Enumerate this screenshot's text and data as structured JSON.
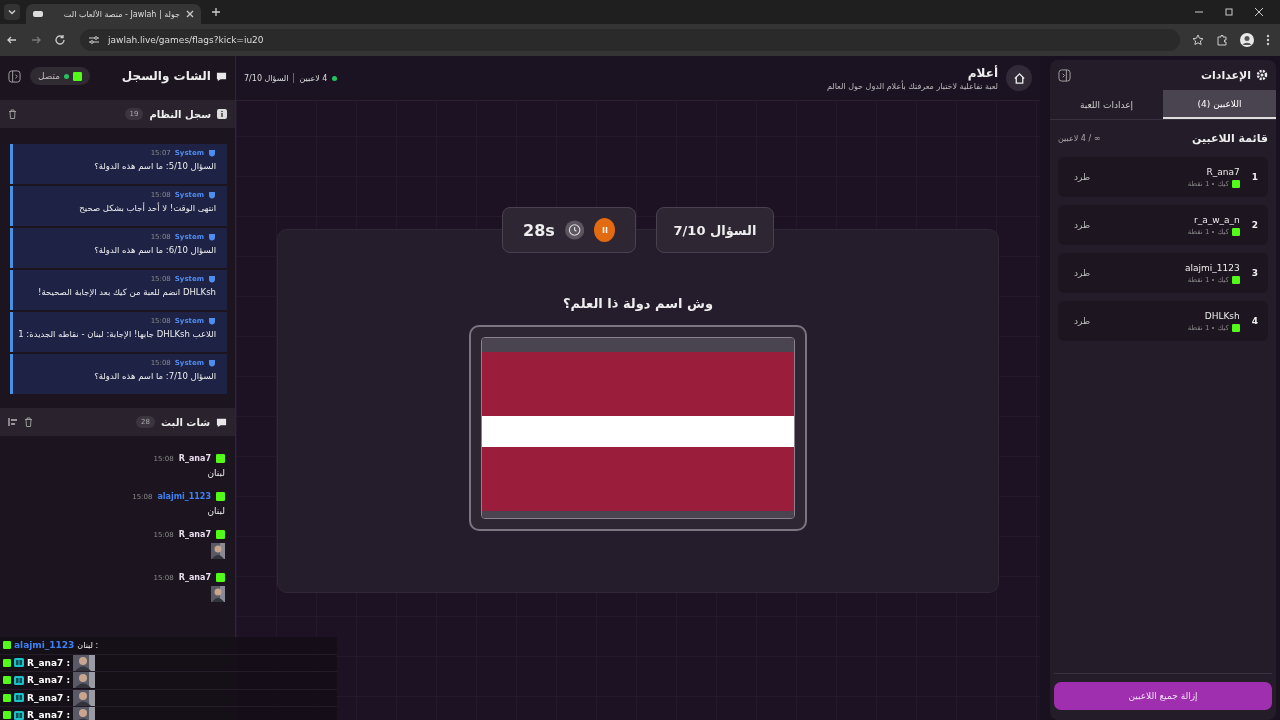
{
  "browser": {
    "tab_title": "جولة | Jawlah - منصة الألعاب الت",
    "url": "jawlah.live/games/flags?kick=iu20"
  },
  "left_panel": {
    "title": "الشات والسجل",
    "status": "متصل",
    "system_log": {
      "title": "سجل النظام",
      "count": "19",
      "entries": [
        {
          "sender": "System",
          "time": "15:07",
          "text": "السؤال 5/10: ما اسم هذه الدولة؟"
        },
        {
          "sender": "System",
          "time": "15:08",
          "text": "انتهى الوقت! لا أحد أجاب بشكل صحيح"
        },
        {
          "sender": "System",
          "time": "15:08",
          "text": "السؤال 6/10: ما اسم هذه الدولة؟"
        },
        {
          "sender": "System",
          "time": "15:08",
          "text": "DHLKsh انضم للعبة من كيك بعد الإجابة الصحيحة!"
        },
        {
          "sender": "System",
          "time": "15:08",
          "text": "اللاعب DHLKsh جابها! الإجابة: لبنان - نقاطه الجديدة: 1"
        },
        {
          "sender": "System",
          "time": "15:08",
          "text": "السؤال 7/10: ما اسم هذه الدولة؟"
        }
      ]
    },
    "stream_chat": {
      "title": "شات البث",
      "count": "28",
      "messages": [
        {
          "user": "R_ana7",
          "color": "#e8dced",
          "time": "15:08",
          "kind": "text",
          "text": "لبنان"
        },
        {
          "user": "alajmi_1123",
          "color": "#3b82f6",
          "time": "15:08",
          "kind": "text",
          "text": "لبنان"
        },
        {
          "user": "R_ana7",
          "color": "#e8dced",
          "time": "15:08",
          "kind": "emote"
        },
        {
          "user": "R_ana7",
          "color": "#e8dced",
          "time": "15:08",
          "kind": "emote"
        }
      ]
    }
  },
  "overlay": {
    "lines": [
      {
        "user": "alajmi_1123",
        "color": "#3b82f6",
        "badge": false,
        "kind": "text",
        "text": ": لبنان"
      },
      {
        "user": "R_ana7 :",
        "color": "#ffffff",
        "badge": true,
        "kind": "emote"
      },
      {
        "user": "R_ana7 :",
        "color": "#ffffff",
        "badge": true,
        "kind": "emote"
      },
      {
        "user": "R_ana7 :",
        "color": "#ffffff",
        "badge": true,
        "kind": "emote"
      },
      {
        "user": "R_ana7 :",
        "color": "#ffffff",
        "badge": true,
        "kind": "emote"
      }
    ]
  },
  "header": {
    "title": "أعلام",
    "subtitle": "لعبة تفاعلية لاختبار معرفتك بأعلام الدول حول العالم",
    "players": "4 لاعبين",
    "question": "السؤال 7/10"
  },
  "game": {
    "question_badge": "السؤال 7/10",
    "timer": "28s",
    "question": "وش اسم دولة ذا العلم؟"
  },
  "right_panel": {
    "title": "الإعدادات",
    "tabs": [
      {
        "label": "اللاعبين (4)",
        "selected": true
      },
      {
        "label": "إعدادات اللعبة",
        "selected": false
      }
    ],
    "list_title": "قائمة اللاعبين",
    "capacity": "∞ / 4 لاعبين",
    "players": [
      {
        "rank": "1",
        "name": "R_ana7",
        "platform": "كيك",
        "points": "1 نقطة",
        "kick": "طرد"
      },
      {
        "rank": "2",
        "name": "r_a_w_a_n",
        "platform": "كيك",
        "points": "1 نقطة",
        "kick": "طرد"
      },
      {
        "rank": "3",
        "name": "alajmi_1123",
        "platform": "كيك",
        "points": "1 نقطة",
        "kick": "طرد"
      },
      {
        "rank": "4",
        "name": "DHLKsh",
        "platform": "كيك",
        "points": "1 نقطة",
        "kick": "طرد"
      }
    ],
    "remove_all": "إزالة جميع اللاعبين"
  }
}
